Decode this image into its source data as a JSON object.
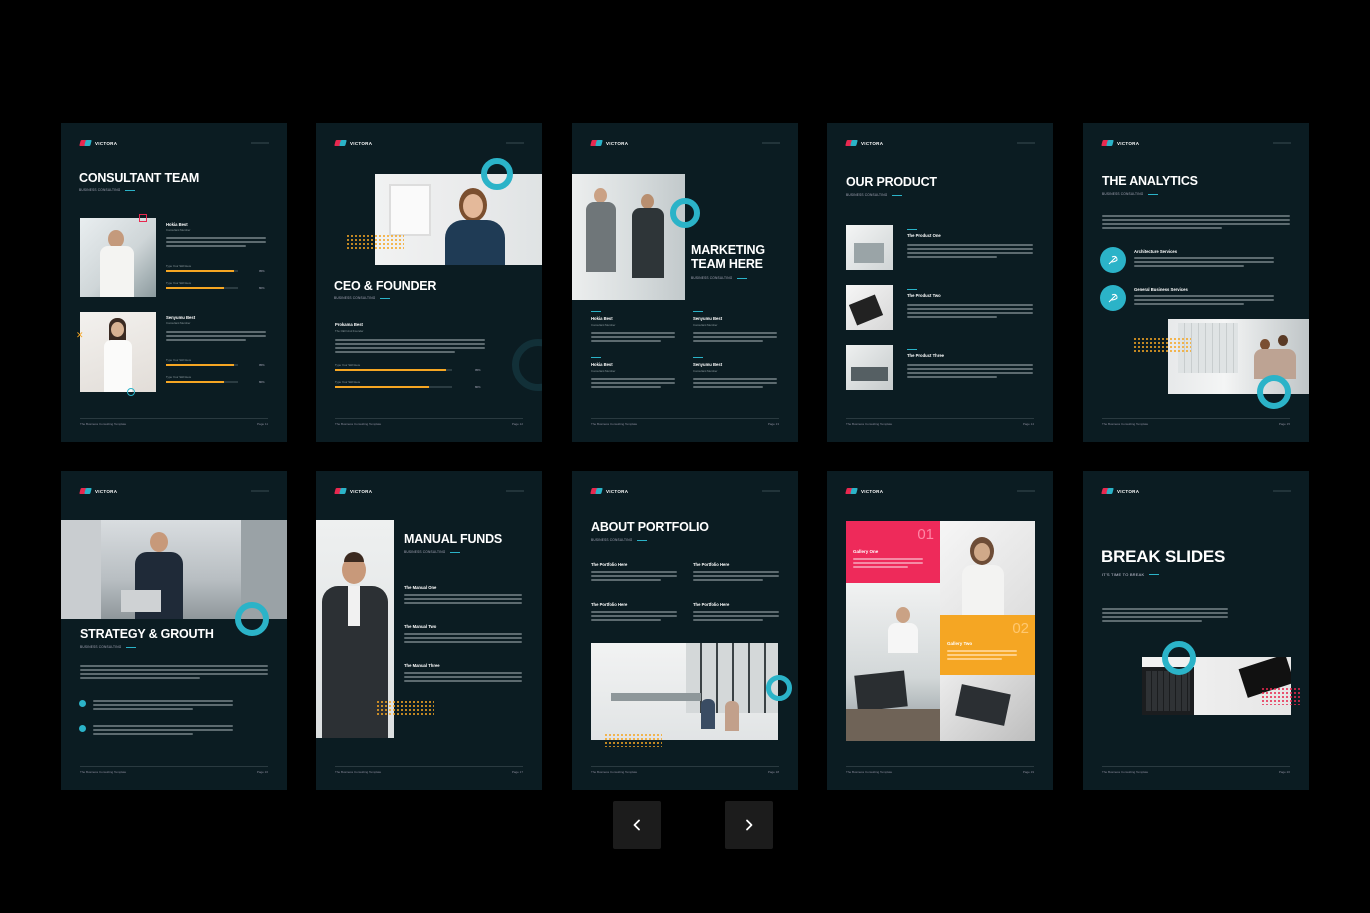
{
  "brand": "VICTORA",
  "footer_left": "The Business Consulting Template",
  "colors": {
    "background": "#000000",
    "slide": "#0b1c22",
    "accent": "#2bb3c8",
    "orange": "#f5a623",
    "pink": "#e8284f"
  },
  "slides": {
    "consultant": {
      "title": "CONSULTANT TEAM",
      "sub": "BUSINESS CONSULTING",
      "page": "Page 11",
      "people": [
        {
          "name": "Hokia Best",
          "role": "Consultant Member",
          "skill1": "Type Your Skill Here",
          "pct1": "95%",
          "p1": 0.95,
          "skill2": "Type Your Skill Here",
          "pct2": "80%",
          "p2": 0.8
        },
        {
          "name": "Senyumu Best",
          "role": "Consultant Member",
          "skill1": "Type Your Skill Here",
          "pct1": "95%",
          "p1": 0.95,
          "skill2": "Type Your Skill Here",
          "pct2": "80%",
          "p2": 0.8
        }
      ]
    },
    "ceo": {
      "title": "CEO & FOUNDER",
      "sub": "BUSINESS CONSULTING",
      "name": "Prokama Best",
      "role": "The CEO And Founder",
      "skill1": "Type Your Skill Here",
      "pct1": "95%",
      "p1": 0.95,
      "skill2": "Type Your Skill Here",
      "pct2": "80%",
      "p2": 0.8,
      "page": "Page 12"
    },
    "marketing": {
      "title1": "MARKETING",
      "title2": "TEAM HERE",
      "sub": "BUSINESS CONSULTING",
      "page": "Page 13",
      "people": [
        {
          "name": "Hokia Best",
          "role": "Consultant Member"
        },
        {
          "name": "Senyumu Best",
          "role": "Consultant Member"
        },
        {
          "name": "Hokia Best",
          "role": "Consultant Member"
        },
        {
          "name": "Senyumu Best",
          "role": "Consultant Member"
        }
      ]
    },
    "product": {
      "title": "OUR PRODUCT",
      "sub": "BUSINESS CONSULTING",
      "page": "Page 14",
      "items": [
        "The Product One",
        "The Product Two",
        "The Product Three"
      ]
    },
    "analytics": {
      "title": "THE ANALYTICS",
      "sub": "BUSINESS CONSULTING",
      "page": "Page 15",
      "services": [
        "Architecture Services",
        "General Business Services"
      ]
    },
    "strategy": {
      "title": "STRATEGY & GROUTH",
      "sub": "BUSINESS CONSULTING",
      "page": "Page 16"
    },
    "manual": {
      "title": "MANUAL FUNDS",
      "sub": "BUSINESS CONSULTING",
      "page": "Page 17",
      "items": [
        "The Manual One",
        "The Manual Two",
        "The Manual Three"
      ]
    },
    "portfolio": {
      "title": "ABOUT PORTFOLIO",
      "sub": "BUSINESS CONSULTING",
      "page": "Page 18",
      "items": [
        "The Portfolio Here",
        "The Portfolio Here",
        "The Portfolio Here",
        "The Portfolio Here"
      ]
    },
    "gallery": {
      "num1": "01",
      "label1": "Gallery One",
      "num2": "02",
      "label2": "Gallery Two",
      "page": "Page 19"
    },
    "break": {
      "title": "BREAK SLIDES",
      "sub": "IT'S TIME TO BREAK",
      "page": "Page 20"
    }
  },
  "nav": {
    "prev": "chevron-left-icon",
    "next": "chevron-right-icon"
  }
}
